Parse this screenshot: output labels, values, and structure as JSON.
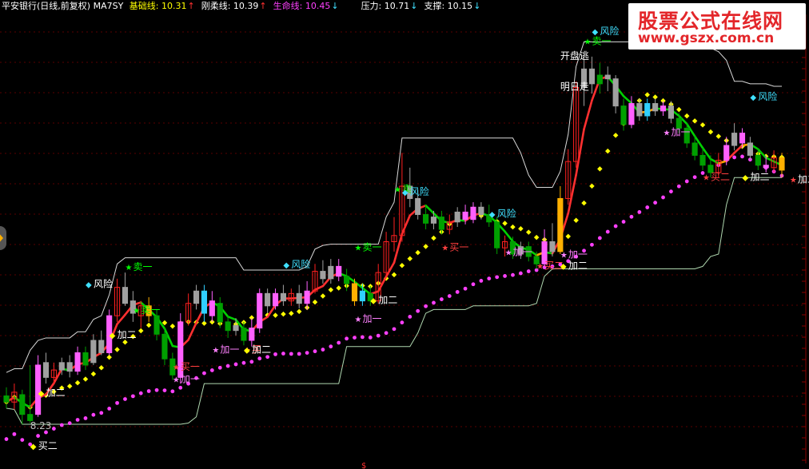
{
  "header": {
    "title": "平安银行(日线,前复权) MA7SY",
    "items": [
      {
        "label": "基础线:",
        "value": "10.31",
        "arrow": "↑",
        "color": "#ffff00"
      },
      {
        "label": "刚柔线:",
        "value": "10.39",
        "arrow": "↑",
        "color": "#ffffff"
      },
      {
        "label": "生命线:",
        "value": "10.45",
        "arrow": "↓",
        "color": "#ff40ff"
      },
      {
        "label": "压力:",
        "value": "10.71",
        "arrow": "↓",
        "color": "#ffffff"
      },
      {
        "label": "支撑:",
        "value": "10.15",
        "arrow": "↓",
        "color": "#ffffff"
      }
    ]
  },
  "watermark": {
    "line1": "股票公式在线网",
    "line2": "www.gszx.com.cn"
  },
  "colors": {
    "up": "#ff3232",
    "down": "#00c000",
    "pressure": "#ffffff",
    "support": "#ffffff",
    "lifeline": "#ff40ff",
    "baseline": "#ffff00",
    "rigid_up": "#ff3030",
    "rigid_mid": "#ffa500",
    "rigid_down": "#00d000"
  },
  "chart_data": {
    "type": "candlestick",
    "y_range": [
      8.0,
      11.4
    ],
    "candles": [
      [
        8.45,
        8.4,
        8.35,
        8.52,
        "g"
      ],
      [
        8.4,
        8.48,
        8.34,
        8.55,
        "r"
      ],
      [
        8.46,
        8.3,
        8.22,
        8.5,
        "g"
      ],
      [
        8.3,
        8.25,
        8.23,
        8.7,
        "g"
      ],
      [
        8.3,
        8.7,
        8.28,
        8.78,
        "m"
      ],
      [
        8.72,
        8.6,
        8.55,
        8.8,
        "w"
      ],
      [
        8.6,
        8.66,
        8.55,
        8.72,
        "r"
      ],
      [
        8.66,
        8.72,
        8.62,
        8.76,
        "w"
      ],
      [
        8.72,
        8.65,
        8.6,
        8.78,
        "w"
      ],
      [
        8.65,
        8.8,
        8.62,
        8.85,
        "m"
      ],
      [
        8.8,
        8.7,
        8.66,
        8.85,
        "g"
      ],
      [
        8.72,
        8.9,
        8.7,
        8.95,
        "w"
      ],
      [
        8.9,
        8.8,
        8.78,
        8.98,
        "w"
      ],
      [
        8.8,
        9.1,
        8.78,
        9.15,
        "m"
      ],
      [
        9.1,
        9.33,
        9.05,
        9.4,
        "r"
      ],
      [
        9.33,
        9.2,
        9.18,
        9.45,
        "w"
      ],
      [
        9.22,
        9.12,
        9.05,
        9.3,
        "w"
      ],
      [
        9.1,
        9.18,
        9.0,
        9.22,
        "r"
      ],
      [
        9.18,
        9.1,
        9.05,
        9.25,
        "y"
      ],
      [
        9.1,
        8.95,
        8.9,
        9.15,
        "g"
      ],
      [
        8.95,
        8.75,
        8.7,
        9.0,
        "g"
      ],
      [
        8.75,
        8.62,
        8.58,
        8.8,
        "g"
      ],
      [
        8.6,
        9.05,
        8.55,
        9.12,
        "m"
      ],
      [
        9.05,
        9.2,
        9.02,
        9.28,
        "r"
      ],
      [
        9.2,
        9.3,
        9.15,
        9.35,
        "w"
      ],
      [
        9.3,
        9.12,
        9.05,
        9.35,
        "c"
      ],
      [
        9.1,
        9.22,
        9.05,
        9.3,
        "m"
      ],
      [
        9.2,
        9.05,
        9.0,
        9.25,
        "g"
      ],
      [
        9.05,
        8.98,
        8.92,
        9.1,
        "g"
      ],
      [
        8.98,
        9.02,
        8.94,
        9.08,
        "w"
      ],
      [
        9.0,
        8.9,
        8.86,
        9.05,
        "g"
      ],
      [
        8.9,
        9.0,
        8.85,
        9.08,
        "m"
      ],
      [
        9.0,
        9.28,
        8.96,
        9.32,
        "m"
      ],
      [
        9.28,
        9.18,
        9.12,
        9.32,
        "w"
      ],
      [
        9.18,
        9.28,
        9.15,
        9.32,
        "m"
      ],
      [
        9.28,
        9.22,
        9.18,
        9.35,
        "w"
      ],
      [
        9.22,
        9.28,
        9.18,
        9.32,
        "r"
      ],
      [
        9.28,
        9.2,
        9.16,
        9.35,
        "w"
      ],
      [
        9.2,
        9.3,
        9.15,
        9.38,
        "m"
      ],
      [
        9.3,
        9.46,
        9.28,
        9.52,
        "r"
      ],
      [
        9.46,
        9.4,
        9.36,
        9.55,
        "w"
      ],
      [
        9.4,
        9.5,
        9.36,
        9.56,
        "w"
      ],
      [
        9.5,
        9.42,
        9.38,
        9.56,
        "m"
      ],
      [
        9.42,
        9.36,
        9.3,
        9.48,
        "g"
      ],
      [
        9.36,
        9.22,
        9.18,
        9.4,
        "y"
      ],
      [
        9.22,
        9.3,
        9.18,
        9.36,
        "c"
      ],
      [
        9.28,
        9.22,
        9.18,
        9.34,
        "g"
      ],
      [
        9.22,
        9.45,
        9.2,
        9.52,
        "r"
      ],
      [
        9.45,
        9.7,
        9.42,
        9.78,
        "r"
      ],
      [
        9.7,
        9.75,
        9.62,
        9.9,
        "r"
      ],
      [
        9.75,
        10.15,
        9.7,
        10.42,
        "r"
      ],
      [
        10.15,
        10.05,
        9.98,
        10.3,
        "w"
      ],
      [
        10.05,
        9.92,
        9.88,
        10.12,
        "w"
      ],
      [
        9.92,
        9.85,
        9.8,
        10.0,
        "g"
      ],
      [
        9.85,
        9.9,
        9.8,
        9.95,
        "w"
      ],
      [
        9.9,
        9.8,
        9.76,
        9.95,
        "g"
      ],
      [
        9.8,
        9.86,
        9.76,
        9.92,
        "r"
      ],
      [
        9.86,
        9.94,
        9.82,
        9.98,
        "w"
      ],
      [
        9.94,
        9.88,
        9.84,
        10.0,
        "m"
      ],
      [
        9.88,
        9.98,
        9.85,
        10.02,
        "m"
      ],
      [
        9.98,
        9.92,
        9.88,
        10.02,
        "w"
      ],
      [
        9.92,
        9.86,
        9.82,
        10.0,
        "g"
      ],
      [
        9.86,
        9.65,
        9.6,
        9.9,
        "g"
      ],
      [
        9.65,
        9.7,
        9.58,
        9.75,
        "r"
      ],
      [
        9.7,
        9.6,
        9.56,
        9.74,
        "g"
      ],
      [
        9.6,
        9.66,
        9.56,
        9.7,
        "w"
      ],
      [
        9.66,
        9.58,
        9.54,
        9.7,
        "g"
      ],
      [
        9.58,
        9.52,
        9.48,
        9.62,
        "g"
      ],
      [
        9.52,
        9.7,
        9.5,
        9.8,
        "m"
      ],
      [
        9.7,
        9.62,
        9.58,
        9.85,
        "w"
      ],
      [
        9.62,
        10.05,
        9.6,
        10.15,
        "y"
      ],
      [
        10.05,
        10.35,
        10.0,
        10.45,
        "r"
      ],
      [
        10.35,
        10.95,
        10.3,
        11.0,
        "r"
      ],
      [
        10.95,
        11.1,
        10.8,
        11.2,
        "w"
      ],
      [
        11.1,
        10.98,
        10.9,
        11.2,
        "w"
      ],
      [
        10.98,
        11.05,
        10.9,
        11.15,
        "g"
      ],
      [
        11.05,
        11.02,
        10.92,
        11.12,
        "w"
      ],
      [
        11.02,
        10.8,
        10.74,
        11.05,
        "w"
      ],
      [
        10.8,
        10.65,
        10.6,
        10.86,
        "g"
      ],
      [
        10.65,
        10.82,
        10.62,
        10.88,
        "m"
      ],
      [
        10.82,
        10.72,
        10.68,
        10.86,
        "w"
      ],
      [
        10.72,
        10.82,
        10.68,
        10.86,
        "c"
      ],
      [
        10.82,
        10.76,
        10.72,
        10.86,
        "w"
      ],
      [
        10.76,
        10.8,
        10.72,
        10.84,
        "m"
      ],
      [
        10.8,
        10.7,
        10.66,
        10.84,
        "w"
      ],
      [
        10.7,
        10.62,
        10.58,
        10.74,
        "g"
      ],
      [
        10.62,
        10.5,
        10.46,
        10.66,
        "g"
      ],
      [
        10.5,
        10.4,
        10.36,
        10.56,
        "g"
      ],
      [
        10.4,
        10.32,
        10.28,
        10.46,
        "g"
      ],
      [
        10.32,
        10.26,
        10.22,
        10.4,
        "g"
      ],
      [
        10.26,
        10.36,
        10.22,
        10.42,
        "r"
      ],
      [
        10.36,
        10.48,
        10.32,
        10.55,
        "m"
      ],
      [
        10.48,
        10.58,
        10.44,
        10.66,
        "w"
      ],
      [
        10.58,
        10.5,
        10.46,
        10.62,
        "m"
      ],
      [
        10.5,
        10.4,
        10.36,
        10.55,
        "w"
      ],
      [
        10.4,
        10.32,
        10.28,
        10.46,
        "g"
      ],
      [
        10.32,
        10.3,
        10.26,
        10.4,
        "m"
      ],
      [
        10.3,
        10.38,
        10.26,
        10.44,
        "r"
      ],
      [
        10.38,
        10.28,
        10.22,
        10.42,
        "y"
      ]
    ],
    "resistance_level": 10.71,
    "support_level": 10.15,
    "labels": [
      {
        "text": "8.23",
        "i": 3,
        "y": 8.18,
        "color": "#c0c0c0",
        "mark": ""
      },
      {
        "text": "买二",
        "i": 3,
        "y": 8.02,
        "color": "#ffffff",
        "mark": "◆",
        "markColor": "#ffff00"
      },
      {
        "text": "加二",
        "i": 4,
        "y": 8.45,
        "color": "#ffffff",
        "mark": "◆",
        "markColor": "#ffff00"
      },
      {
        "text": "加二",
        "i": 13,
        "y": 8.92,
        "color": "#ffffff",
        "mark": "◆",
        "markColor": "#ffff00"
      },
      {
        "text": "卖一",
        "i": 15,
        "y": 9.47,
        "color": "#00ff00",
        "mark": "★",
        "markColor": "#00ff00"
      },
      {
        "text": "风险",
        "i": 10,
        "y": 9.33,
        "color": "#ffffff",
        "mark": "◆",
        "markColor": "#40e0ff"
      },
      {
        "text": "卖一",
        "i": 16,
        "y": 9.12,
        "color": "#00ff00",
        "mark": "★",
        "markColor": "#00ff00"
      },
      {
        "text": "买一",
        "i": 21,
        "y": 8.66,
        "color": "#ff4040",
        "mark": "★",
        "markColor": "#ff4040"
      },
      {
        "text": "加一",
        "i": 21,
        "y": 8.56,
        "color": "#ff80ff",
        "mark": "★",
        "markColor": "#ff80ff"
      },
      {
        "text": "加一",
        "i": 26,
        "y": 8.8,
        "color": "#ff80ff",
        "mark": "★",
        "markColor": "#ff80ff"
      },
      {
        "text": "买二",
        "i": 30,
        "y": 8.8,
        "color": "#ff4040",
        "mark": "★",
        "markColor": "#ff4040"
      },
      {
        "text": "加二",
        "i": 30,
        "y": 8.8,
        "color": "#ffffff",
        "mark": "◆",
        "markColor": "#ffff00"
      },
      {
        "text": "风险",
        "i": 35,
        "y": 9.49,
        "color": "#40e0ff",
        "mark": "◆",
        "markColor": "#40e0ff"
      },
      {
        "text": "卖一",
        "i": 44,
        "y": 9.63,
        "color": "#00ff00",
        "mark": "★",
        "markColor": "#00ff00"
      },
      {
        "text": "加一",
        "i": 44,
        "y": 9.05,
        "color": "#ff80ff",
        "mark": "★",
        "markColor": "#ff80ff"
      },
      {
        "text": "加二",
        "i": 46,
        "y": 9.2,
        "color": "#ffffff",
        "mark": "◆",
        "markColor": "#ffff00"
      },
      {
        "text": "卖",
        "i": 49,
        "y": 10.1,
        "color": "#00ff00",
        "mark": "★",
        "markColor": "#00ff00"
      },
      {
        "text": "风险",
        "i": 50,
        "y": 10.08,
        "color": "#40e0ff",
        "mark": "◆",
        "markColor": "#40e0ff"
      },
      {
        "text": "买一",
        "i": 55,
        "y": 9.63,
        "color": "#ff4040",
        "mark": "★",
        "markColor": "#ff4040"
      },
      {
        "text": "风险",
        "i": 61,
        "y": 9.9,
        "color": "#40e0ff",
        "mark": "◆",
        "markColor": "#40e0ff"
      },
      {
        "text": "加一",
        "i": 63,
        "y": 9.59,
        "color": "#ff80ff",
        "mark": "★",
        "markColor": "#ff80ff"
      },
      {
        "text": "买二",
        "i": 67,
        "y": 9.48,
        "color": "#ff4040",
        "mark": "★",
        "markColor": "#ff4040"
      },
      {
        "text": "加一",
        "i": 70,
        "y": 9.57,
        "color": "#ff80ff",
        "mark": "★",
        "markColor": "#ff80ff"
      },
      {
        "text": "加二",
        "i": 70,
        "y": 9.48,
        "color": "#ffffff",
        "mark": "◆",
        "markColor": "#ffff00"
      },
      {
        "text": "明日走",
        "i": 70,
        "y": 10.93,
        "color": "#ffffff",
        "mark": "",
        "markColor": ""
      },
      {
        "text": "开盘逃",
        "i": 70,
        "y": 11.18,
        "color": "#ffffff",
        "mark": "",
        "markColor": ""
      },
      {
        "text": "卖一",
        "i": 73,
        "y": 11.3,
        "color": "#00ff00",
        "mark": "★",
        "markColor": "#00ff00"
      },
      {
        "text": "风险",
        "i": 74,
        "y": 11.38,
        "color": "#40e0ff",
        "mark": "◆",
        "markColor": "#40e0ff"
      },
      {
        "text": "加一",
        "i": 83,
        "y": 10.56,
        "color": "#ff80ff",
        "mark": "★",
        "markColor": "#ff80ff"
      },
      {
        "text": "买二",
        "i": 88,
        "y": 10.2,
        "color": "#ff4040",
        "mark": "★",
        "markColor": "#ff4040"
      },
      {
        "text": "风险",
        "i": 94,
        "y": 10.85,
        "color": "#40e0ff",
        "mark": "◆",
        "markColor": "#40e0ff"
      },
      {
        "text": "加二",
        "i": 93,
        "y": 10.2,
        "color": "#ffffff",
        "mark": "◆",
        "markColor": "#ffff00"
      },
      {
        "text": "加二",
        "i": 99,
        "y": 10.18,
        "color": "#ffffff",
        "mark": "★",
        "markColor": "#ff4040"
      }
    ]
  }
}
